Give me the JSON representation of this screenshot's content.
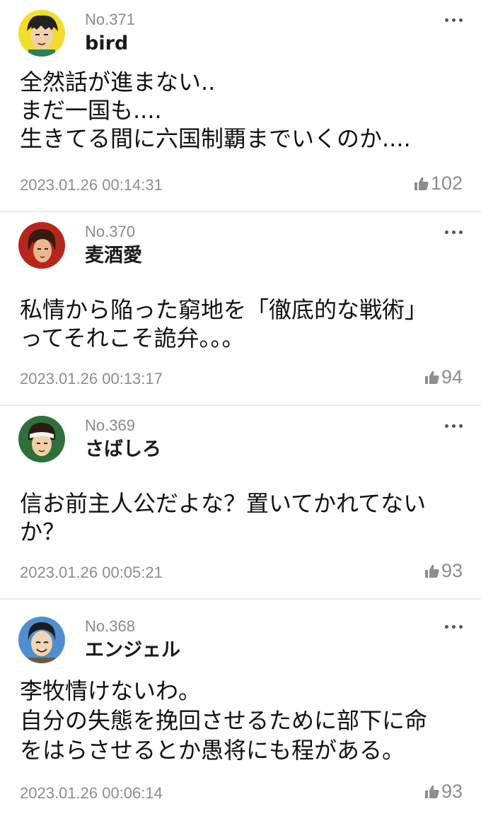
{
  "comments": [
    {
      "number": "No.371",
      "username": "bird",
      "body": [
        "全然話が進まない..",
        "まだ一国も....",
        "生きてる間に六国制覇までいくのか...."
      ],
      "timestamp": "2023.01.26 00:14:31",
      "likes": "102",
      "avatar_icon": "manga-character-avatar",
      "avatar_bg": "#f2dc2c"
    },
    {
      "number": "No.370",
      "username": "麦酒愛",
      "body": [
        "私情から陥った窮地を「徹底的な戦術」",
        "ってそれこそ詭弁。。。"
      ],
      "timestamp": "2023.01.26 00:13:17",
      "likes": "94",
      "avatar_icon": "manga-character-avatar",
      "avatar_bg": "#b7261c"
    },
    {
      "number": "No.369",
      "username": "さばしろ",
      "body": [
        "信お前主人公だよな？置いてかれてない",
        "か？"
      ],
      "timestamp": "2023.01.26 00:05:21",
      "likes": "93",
      "avatar_icon": "manga-character-avatar",
      "avatar_bg": "#2f6f3c"
    },
    {
      "number": "No.368",
      "username": "エンジェル",
      "body": [
        "李牧情けないわ。",
        "自分の失態を挽回させるために部下に命",
        "をはらさせるとか愚将にも程がある。"
      ],
      "timestamp": "2023.01.26 00:06:14",
      "likes": "93",
      "avatar_icon": "manga-character-avatar",
      "avatar_bg": "#4f8fd0"
    }
  ],
  "icons": {
    "more": "more-horizontal-icon",
    "like": "thumbs-up-icon"
  }
}
